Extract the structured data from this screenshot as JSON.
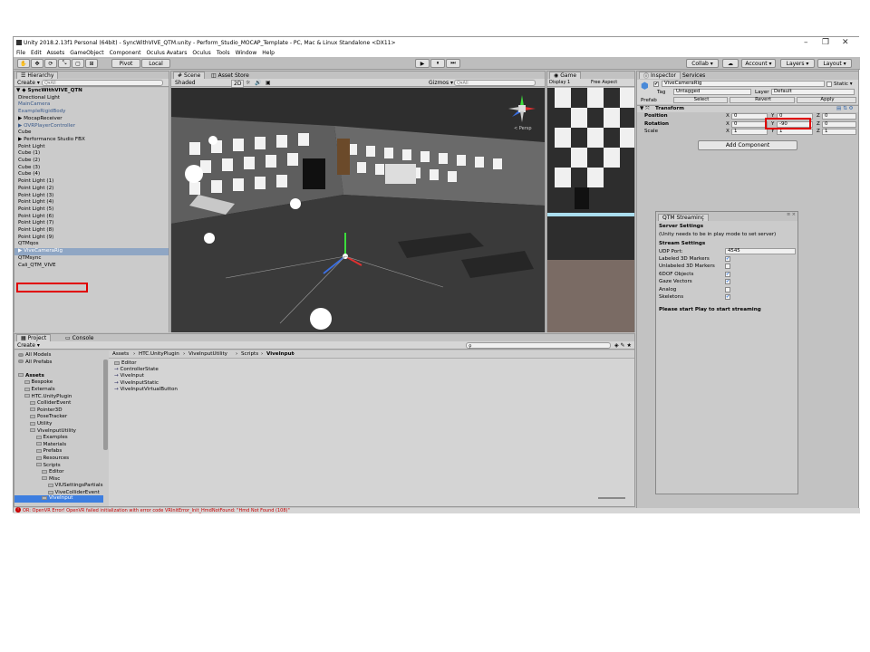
{
  "titlebar": {
    "title": "Unity 2018.2.13f1 Personal (64bit) - SyncWithVIVE_QTM.unity - Perform_Studio_MOCAP_Template - PC, Mac & Linux Standalone <DX11>",
    "minimize": "–",
    "maximize": "❐",
    "close": "✕"
  },
  "menu": [
    "File",
    "Edit",
    "Assets",
    "GameObject",
    "Component",
    "Oculus Avatars",
    "Oculus",
    "Tools",
    "Window",
    "Help"
  ],
  "toolbar": {
    "pivot": "Pivot",
    "local": "Local",
    "collab": "Collab ▾",
    "account": "Account ▾",
    "layers": "Layers ▾",
    "layout": "Layout ▾",
    "play": "▶",
    "pause": "⏸",
    "step": "⏭"
  },
  "hierarchy": {
    "tab": "Hierarchy",
    "create": "Create ▾",
    "search_placeholder": "Q▾All",
    "scene": "SyncWithVIVE_QTN",
    "items": [
      "Directional Light",
      "MainCamera",
      "ExampleRigidBody",
      "▶ MocapReceiver",
      "▶ OVRPlayerController",
      "Cube",
      "▶ Performance Studio FBX",
      "Point Light",
      "Cube (1)",
      "Cube (2)",
      "Cube (3)",
      "Cube (4)",
      "Point Light (1)",
      "Point Light (2)",
      "Point Light (3)",
      "Point Light (4)",
      "Point Light (5)",
      "Point Light (6)",
      "Point Light (7)",
      "Point Light (8)",
      "Point Light (9)",
      "QTMqos",
      "▶ ViveCameraRig",
      "QTMsync",
      "Cali_QTM_VIVE"
    ],
    "selected": "▶ ViveCameraRig"
  },
  "scene": {
    "tab": "Scene",
    "tab2": "Asset Store",
    "shading": "Shaded",
    "mode2d": "2D",
    "gizmos": "Gizmos ▾",
    "search": "Q▾All",
    "persp": "< Persp"
  },
  "game": {
    "tab": "Game",
    "display": "Display 1",
    "aspect": "Free Aspect"
  },
  "inspector": {
    "tab": "Inspector",
    "tab2": "Services",
    "object_name": "ViveCameraRig",
    "static": "Static ▾",
    "tag_label": "Tag",
    "tag_value": "Untagged",
    "layer_label": "Layer",
    "layer_value": "Default",
    "prefab_label": "Prefab",
    "select": "Select",
    "revert": "Revert",
    "apply": "Apply",
    "transform": "Transform",
    "position": {
      "label": "Position",
      "x": "0",
      "y": "0",
      "z": "0"
    },
    "rotation": {
      "label": "Rotation",
      "x": "0",
      "y": "-90",
      "z": "0"
    },
    "scale": {
      "label": "Scale",
      "x": "1",
      "y": "1",
      "z": "1"
    },
    "add_component": "Add Component"
  },
  "qtm": {
    "tab": "QTM Streaminç",
    "server_settings": "Server Settings",
    "note": "(Unity needs to be in play mode to set server)",
    "stream_settings": "Stream Settings",
    "udp_label": "UDP Port:",
    "udp_value": "4545",
    "options": [
      {
        "label": "Labeled 3D Markers",
        "checked": true
      },
      {
        "label": "Unlabeled 3D Markers",
        "checked": false
      },
      {
        "label": "6DOF Objects",
        "checked": true
      },
      {
        "label": "Gaze Vectors",
        "checked": true
      },
      {
        "label": "Analog",
        "checked": false
      },
      {
        "label": "Skeletons",
        "checked": true
      }
    ],
    "start": "Please start Play to start streaming"
  },
  "project": {
    "tab": "Project",
    "tab2": "Console",
    "create": "Create ▾",
    "breadcrumb": [
      "Assets",
      "HTC.UnityPlugin",
      "ViveInputUtility",
      "Scripts",
      "ViveInput"
    ],
    "tree": [
      {
        "label": "All Models",
        "lvl": 0
      },
      {
        "label": "All Prefabs",
        "lvl": 0
      },
      {
        "label": "",
        "lvl": 0
      },
      {
        "label": "Assets",
        "lvl": 0
      },
      {
        "label": "Bespoke",
        "lvl": 1
      },
      {
        "label": "Externals",
        "lvl": 1
      },
      {
        "label": "HTC.UnityPlugin",
        "lvl": 1
      },
      {
        "label": "ColliderEvent",
        "lvl": 2
      },
      {
        "label": "Pointer3D",
        "lvl": 2
      },
      {
        "label": "PoseTracker",
        "lvl": 2
      },
      {
        "label": "Utility",
        "lvl": 2
      },
      {
        "label": "ViveInputUtility",
        "lvl": 2
      },
      {
        "label": "Examples",
        "lvl": 3
      },
      {
        "label": "Materials",
        "lvl": 3
      },
      {
        "label": "Prefabs",
        "lvl": 3
      },
      {
        "label": "Resources",
        "lvl": 3
      },
      {
        "label": "Scripts",
        "lvl": 3
      },
      {
        "label": "Editor",
        "lvl": 4
      },
      {
        "label": "Misc",
        "lvl": 4
      },
      {
        "label": "VIUSettingsPartials",
        "lvl": 5
      },
      {
        "label": "ViveColliderEvent",
        "lvl": 5
      },
      {
        "label": "ViveInput",
        "lvl": 4
      }
    ],
    "files": [
      "Editor",
      "ControllerState",
      "ViveInput",
      "ViveInputStatic",
      "ViveInputVirtualButton"
    ]
  },
  "status": {
    "error": "OR: OpenVR Error! OpenVR failed initialization with error code VRInitError_Init_HmdNotFound: \"Hmd Not Found (108)\""
  },
  "colors": {
    "accent": "#3d7ee0",
    "selection": "#8fa6c4",
    "highlight": "#e00000",
    "error": "#c80000"
  }
}
